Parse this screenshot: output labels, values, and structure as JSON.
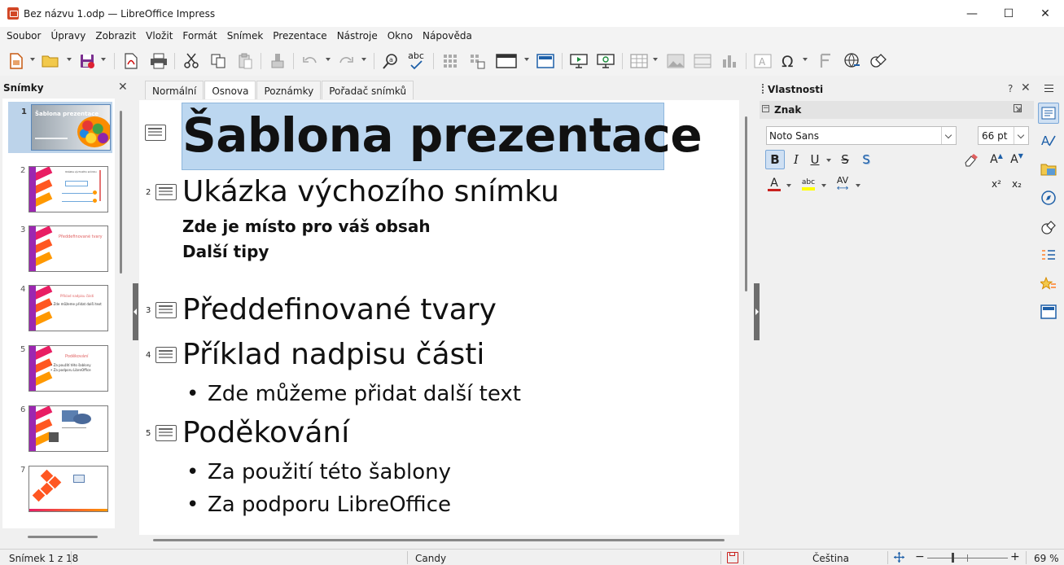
{
  "window": {
    "title": "Bez názvu 1.odp — LibreOffice Impress",
    "minimize": "—",
    "maximize": "☐",
    "close": "✕"
  },
  "menu": [
    "Soubor",
    "Úpravy",
    "Zobrazit",
    "Vložit",
    "Formát",
    "Snímek",
    "Prezentace",
    "Nástroje",
    "Okno",
    "Nápověda"
  ],
  "toolbar": {
    "abc_label": "abc",
    "icons": [
      "new-icon",
      "open-icon",
      "save-icon",
      "export-pdf-icon",
      "print-icon",
      "cut-icon",
      "copy-icon",
      "paste-icon",
      "clone-formatting-icon",
      "undo-icon",
      "redo-icon",
      "find-replace-icon",
      "spellcheck-icon",
      "grid-icon",
      "helplines-icon",
      "display-views-icon",
      "master-slide-icon",
      "start-from-first-icon",
      "start-from-current-icon",
      "table-icon",
      "image-icon",
      "media-icon",
      "chart-icon",
      "textbox-icon",
      "special-character-icon",
      "fontwork-icon",
      "hyperlink-icon",
      "shapes-icon"
    ]
  },
  "slides_pane": {
    "title": "Snímky",
    "close": "✕",
    "slides": [
      {
        "number": "1",
        "thumb_text": "Šablona prezentace",
        "selected": true
      },
      {
        "number": "2",
        "thumb_text": "Ukázka výchozího snímku"
      },
      {
        "number": "3",
        "thumb_text": "Předdefinované tvary"
      },
      {
        "number": "4",
        "thumb_text": "Příklad nadpisu části",
        "thumb_bullet": "• Zde můžeme přidat další text"
      },
      {
        "number": "5",
        "thumb_text": "Poděkování",
        "thumb_bullet": "• Za použití této šablony",
        "thumb_bullet2": "• Za podporu LibreOffice"
      },
      {
        "number": "6",
        "thumb_text": ""
      },
      {
        "number": "7",
        "thumb_text": ""
      }
    ]
  },
  "view_tabs": [
    "Normální",
    "Osnova",
    "Poznámky",
    "Pořadač snímků"
  ],
  "active_view_tab": "Osnova",
  "outline": {
    "slides": [
      {
        "number": "",
        "title": "Šablona prezentace",
        "bold": true
      },
      {
        "number": "2",
        "title": "Ukázka výchozího snímku",
        "body": [
          "Zde je místo pro váš obsah",
          "Další tipy"
        ]
      },
      {
        "number": "3",
        "title": "Předdefinované tvary"
      },
      {
        "number": "4",
        "title": "Příklad nadpisu části",
        "bullets": [
          "Zde můžeme přidat další text"
        ]
      },
      {
        "number": "5",
        "title": "Poděkování",
        "bullets": [
          "Za použití této šablony",
          "Za podporu LibreOffice"
        ]
      }
    ],
    "bullet_glyph": "•"
  },
  "properties": {
    "title": "Vlastnosti",
    "help": "?",
    "close": "✕",
    "character_section": "Znak",
    "collapse_glyph": "−",
    "font_name": "Noto Sans",
    "font_size": "66 pt",
    "bold_label": "B",
    "italic_label": "I",
    "underline_label": "U",
    "strike_label": "S",
    "shadow_label": "S",
    "grow_label": "A",
    "shrink_label": "A",
    "font_color_label": "A",
    "highlight_label": "abc",
    "spacing_label": "AV",
    "superscript_label": "x²",
    "subscript_label": "x₂",
    "font_color": "#c9211e",
    "highlight_color": "#ffff00"
  },
  "deck_icons": [
    "properties-icon",
    "styles-icon",
    "gallery-icon",
    "navigator-icon",
    "shapes-icon",
    "animation-icon",
    "slide-transition-icon",
    "master-slides-icon"
  ],
  "statusbar": {
    "slide_position": "Snímek 1 z 18",
    "master": "Candy",
    "language": "Čeština",
    "zoom": "69 %",
    "zoom_minus": "−",
    "zoom_plus": "+"
  },
  "colors": {
    "selection": "#bcd7f0",
    "accent": "#1d5fa8"
  }
}
